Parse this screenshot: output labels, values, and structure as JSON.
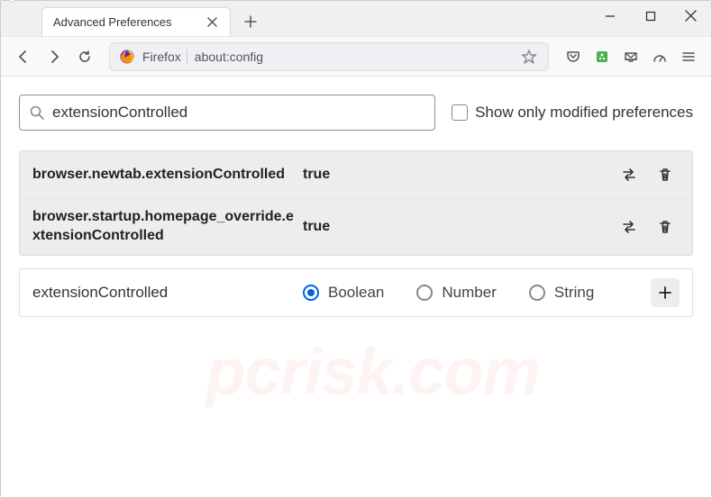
{
  "tab": {
    "title": "Advanced Preferences"
  },
  "addr": {
    "brand": "Firefox",
    "url": "about:config"
  },
  "search": {
    "value": "extensionControlled"
  },
  "filter": {
    "label": "Show only modified preferences"
  },
  "prefs": [
    {
      "name": "browser.newtab.extensionControlled",
      "value": "true"
    },
    {
      "name": "browser.startup.homepage_override.extensionControlled",
      "value": "true"
    }
  ],
  "newpref": {
    "name": "extensionControlled",
    "options": {
      "boolean": "Boolean",
      "number": "Number",
      "string": "String"
    }
  },
  "watermark": "pcrisk.com"
}
